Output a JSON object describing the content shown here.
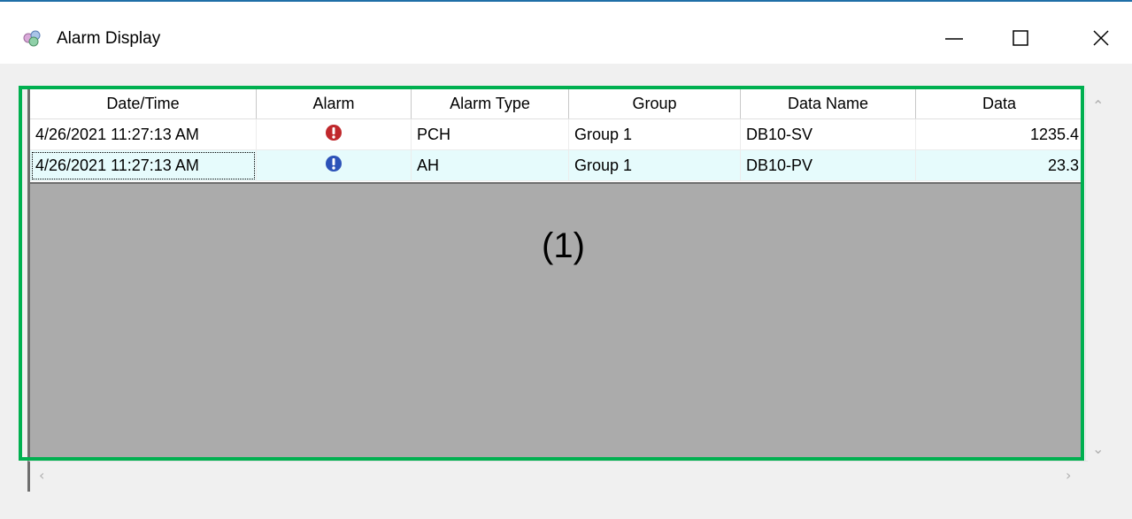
{
  "window": {
    "title": "Alarm Display",
    "icons": {
      "app": "alarm-display-app-icon",
      "minimize": "minimize-icon",
      "maximize": "maximize-icon",
      "close": "close-icon"
    }
  },
  "table": {
    "columns": [
      "Date/Time",
      "Alarm",
      "Alarm Type",
      "Group",
      "Data Name",
      "Data"
    ],
    "rows": [
      {
        "datetime": "4/26/2021 11:27:13 AM",
        "alarm_icon": "red-exclamation-icon",
        "alarm_type": "PCH",
        "group": "Group 1",
        "data_name": "DB10-SV",
        "data": "1235.4"
      },
      {
        "datetime": "4/26/2021 11:27:13 AM",
        "alarm_icon": "blue-exclamation-icon",
        "alarm_type": "AH",
        "group": "Group 1",
        "data_name": "DB10-PV",
        "data": "23.3"
      }
    ]
  },
  "annotation": {
    "label": "(1)",
    "color": "#00b050"
  },
  "colors": {
    "alarm_red": "#c0282c",
    "alarm_blue": "#2c52b8",
    "selected_row": "#e6fbfc",
    "empty_area": "#ababab",
    "title_border": "#1f6fa7"
  }
}
